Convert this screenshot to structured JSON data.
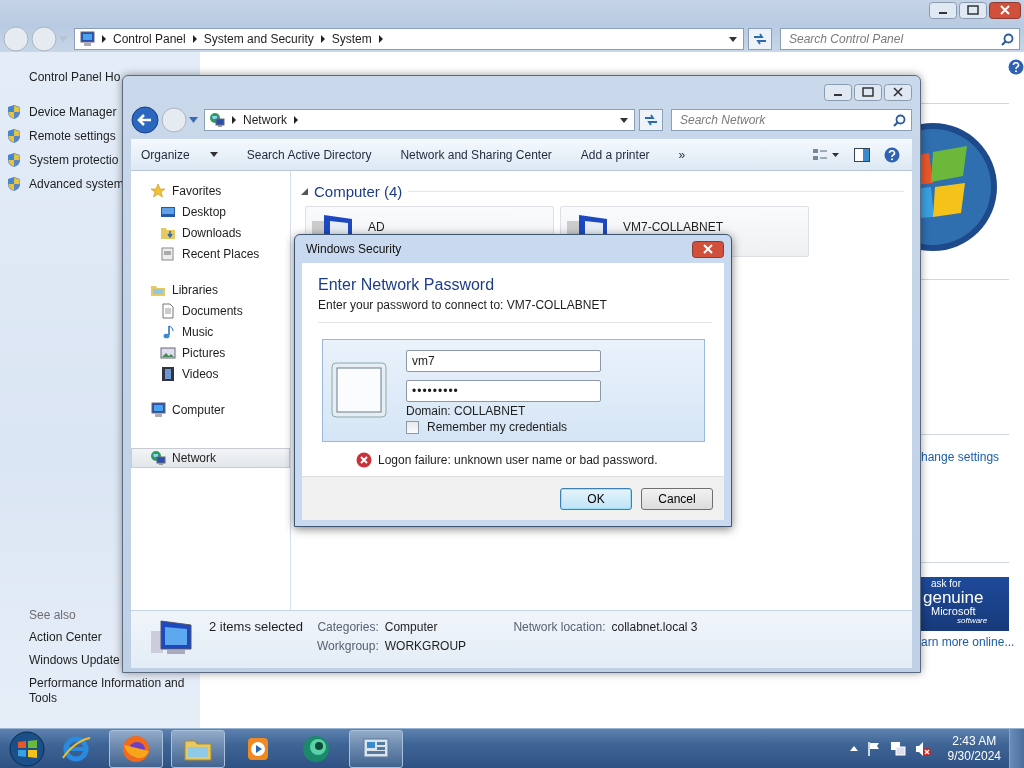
{
  "control_panel_window": {
    "breadcrumb": [
      "Control Panel",
      "System and Security",
      "System"
    ],
    "search": {
      "placeholder": "Search Control Panel"
    },
    "sidebar": {
      "home": "Control Panel Ho",
      "tasks": [
        "Device Manager",
        "Remote settings",
        "System protectio",
        "Advanced system"
      ],
      "see_also_title": "See also",
      "see_also": [
        "Action Center",
        "Windows Update",
        "Performance Information and Tools"
      ]
    },
    "content": {
      "link": "hange settings",
      "badge": [
        "ask for",
        "genuine",
        "Microsoft",
        "software"
      ],
      "learn_more": "arn more online..."
    }
  },
  "network_window": {
    "breadcrumb": [
      "Network"
    ],
    "search": {
      "placeholder": "Search Network"
    },
    "commands": [
      {
        "label": "Organize",
        "dropdown": true
      },
      {
        "label": "Search Active Directory",
        "dropdown": false
      },
      {
        "label": "Network and Sharing Center",
        "dropdown": false
      },
      {
        "label": "Add a printer",
        "dropdown": false
      },
      {
        "label": "»",
        "dropdown": false
      }
    ],
    "nav": [
      {
        "label": "Favorites",
        "kind": "star",
        "selected": false,
        "children": [
          {
            "label": "Desktop",
            "kind": "desktop",
            "selected": false
          },
          {
            "label": "Downloads",
            "kind": "downloads",
            "selected": false
          },
          {
            "label": "Recent Places",
            "kind": "recent",
            "selected": false
          }
        ]
      },
      {
        "label": "Libraries",
        "kind": "library",
        "selected": false,
        "children": [
          {
            "label": "Documents",
            "kind": "document",
            "selected": false
          },
          {
            "label": "Music",
            "kind": "music",
            "selected": false
          },
          {
            "label": "Pictures",
            "kind": "pictures",
            "selected": false
          },
          {
            "label": "Videos",
            "kind": "videos",
            "selected": false
          }
        ]
      },
      {
        "label": "Computer",
        "kind": "computer",
        "selected": false
      },
      {
        "label": "Network",
        "kind": "network",
        "selected": true
      }
    ],
    "group": {
      "title": "Computer (4)",
      "expanded": true,
      "items": [
        "AD",
        "VM7-COLLABNET"
      ]
    },
    "details": {
      "summary": "2 items selected",
      "fields": [
        {
          "label": "Categories:",
          "value": "Computer"
        },
        {
          "label": "Workgroup:",
          "value": "WORKGROUP"
        },
        {
          "label": "Network location:",
          "value": "collabnet.local 3"
        }
      ]
    }
  },
  "dialog": {
    "title": "Windows Security",
    "heading": "Enter Network Password",
    "subtitle": "Enter your password to connect to: VM7-COLLABNET",
    "username": "vm7",
    "password_mask": "•••••••••",
    "domain": "Domain: COLLABNET",
    "remember": {
      "label": "Remember my credentials",
      "checked": false
    },
    "error": "Logon failure: unknown user name or bad password.",
    "buttons": [
      {
        "label": "OK",
        "default": true
      },
      {
        "label": "Cancel",
        "default": false
      }
    ]
  },
  "taskbar": {
    "apps": [
      {
        "kind": "ie",
        "running": false
      },
      {
        "kind": "firefox",
        "running": true
      },
      {
        "kind": "explorer",
        "running": true
      },
      {
        "kind": "media",
        "running": false
      },
      {
        "kind": "teal",
        "running": false
      },
      {
        "kind": "control",
        "running": true
      }
    ],
    "clock": {
      "time": "2:43 AM",
      "date": "9/30/2024"
    }
  }
}
